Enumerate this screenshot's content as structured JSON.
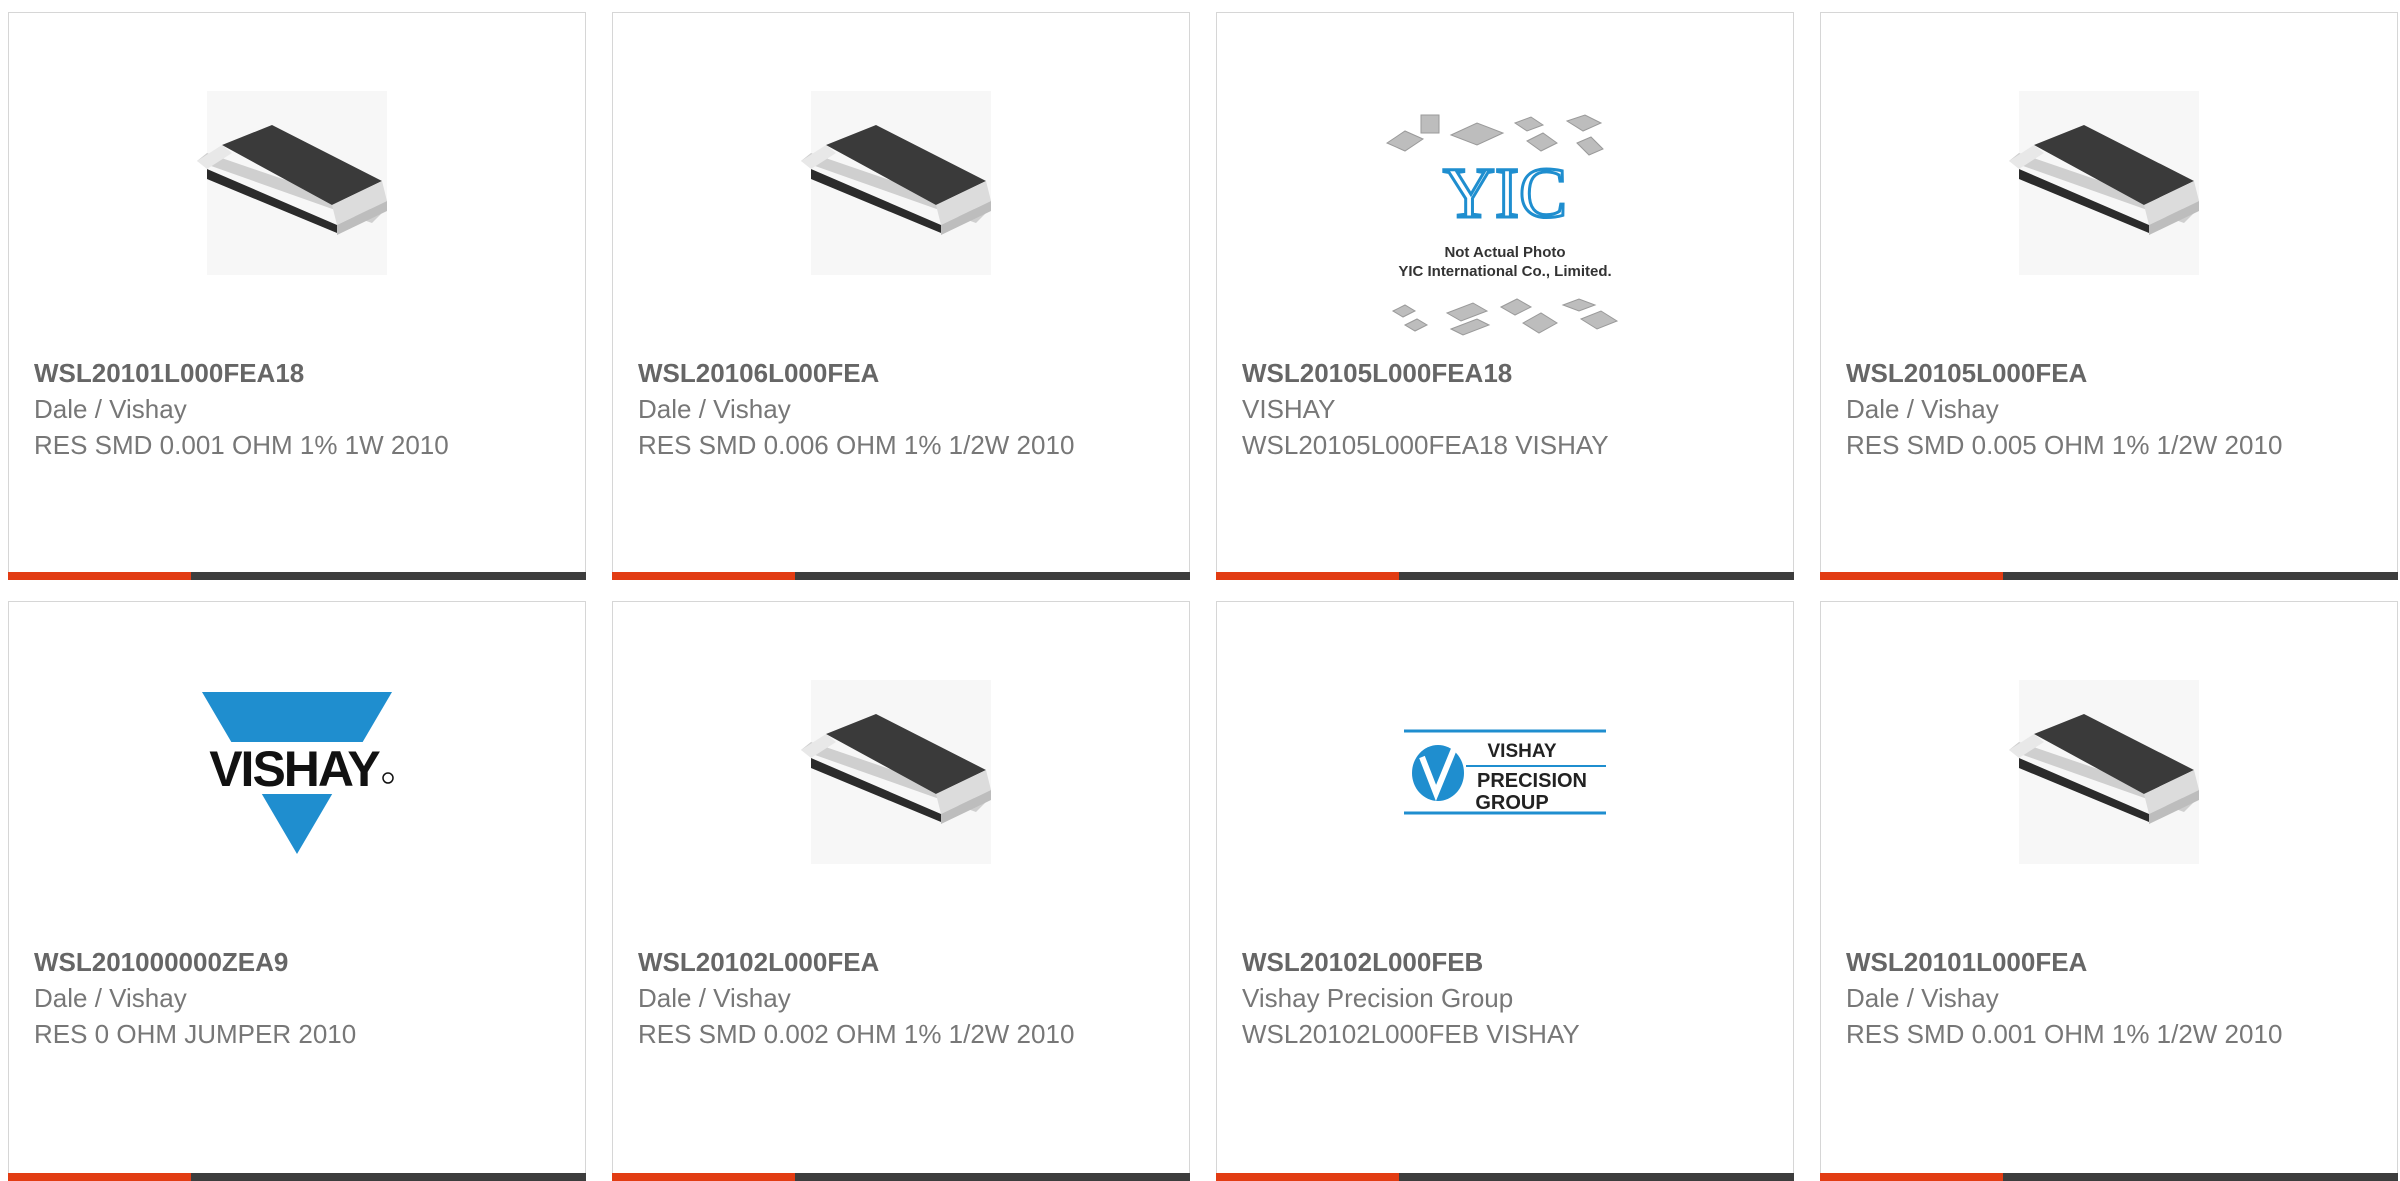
{
  "products": [
    {
      "part_number": "WSL20101L000FEA18",
      "manufacturer": "Dale / Vishay",
      "description": "RES SMD 0.001 OHM 1% 1W 2010",
      "image": "smd-resistor-image"
    },
    {
      "part_number": "WSL20106L000FEA",
      "manufacturer": "Dale / Vishay",
      "description": "RES SMD 0.006 OHM 1% 1/2W 2010",
      "image": "smd-resistor-image"
    },
    {
      "part_number": "WSL20105L000FEA18",
      "manufacturer": "VISHAY",
      "description": "WSL20105L000FEA18 VISHAY",
      "image": "yic-placeholder-image",
      "image_text": {
        "logo": "YIC",
        "line1": "Not Actual Photo",
        "line2": "YIC International Co., Limited."
      }
    },
    {
      "part_number": "WSL20105L000FEA",
      "manufacturer": "Dale / Vishay",
      "description": "RES SMD 0.005 OHM 1% 1/2W 2010",
      "image": "smd-resistor-image"
    },
    {
      "part_number": "WSL201000000ZEA9",
      "manufacturer": "Dale / Vishay",
      "description": "RES 0 OHM JUMPER 2010",
      "image": "vishay-logo",
      "image_text": {
        "logo": "VISHAY"
      }
    },
    {
      "part_number": "WSL20102L000FEA",
      "manufacturer": "Dale / Vishay",
      "description": "RES SMD 0.002 OHM 1% 1/2W 2010",
      "image": "smd-resistor-image"
    },
    {
      "part_number": "WSL20102L000FEB",
      "manufacturer": "Vishay Precision Group",
      "description": "WSL20102L000FEB VISHAY",
      "image": "vpg-logo",
      "image_text": {
        "line1": "VISHAY",
        "line2": "PRECISION",
        "line3": "GROUP"
      }
    },
    {
      "part_number": "WSL20101L000FEA",
      "manufacturer": "Dale / Vishay",
      "description": "RES SMD 0.001 OHM 1% 1/2W 2010",
      "image": "smd-resistor-image"
    }
  ],
  "colors": {
    "accent_orange": "#e23c13",
    "accent_dark": "#3d3d3d",
    "vishay_blue": "#1f8ecf",
    "text_gray": "#777777"
  }
}
